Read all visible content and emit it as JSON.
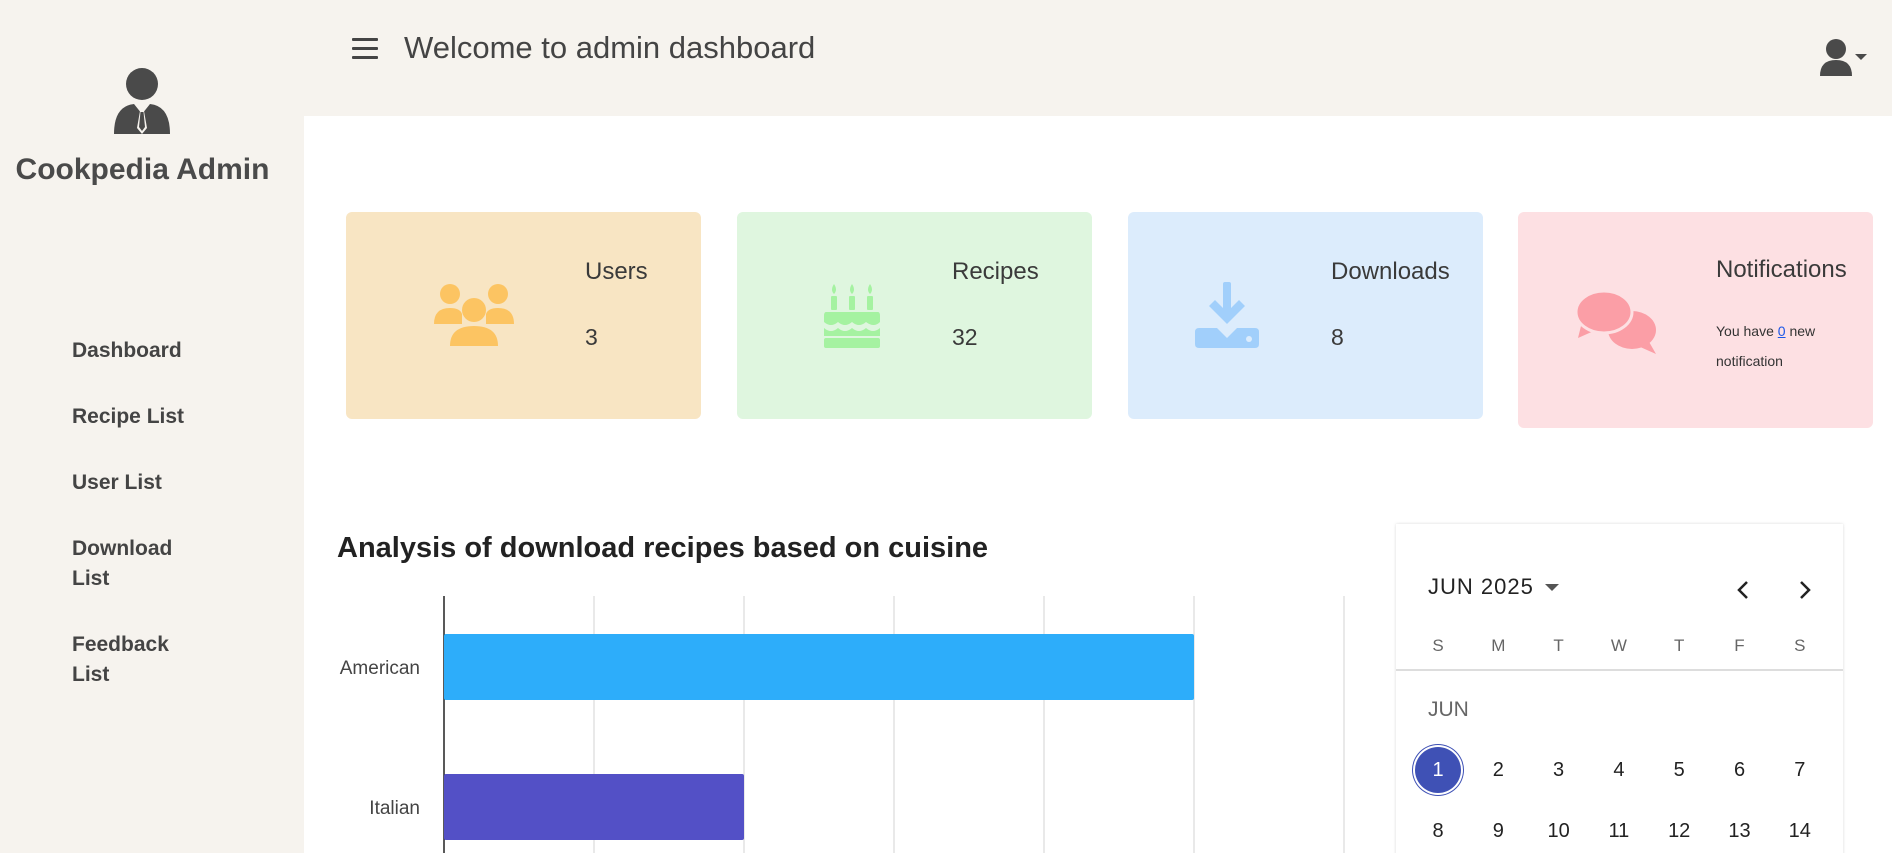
{
  "sidebar": {
    "brand": "Cookpedia Admin",
    "items": [
      {
        "label": "Dashboard"
      },
      {
        "label": "Recipe List"
      },
      {
        "label": "User List"
      },
      {
        "label": "Download List"
      },
      {
        "label": "Feedback List"
      }
    ]
  },
  "header": {
    "title": "Welcome to admin dashboard"
  },
  "cards": {
    "users": {
      "label": "Users",
      "value": "3",
      "color": "#f8e5c3",
      "icon_color": "#fcc462",
      "icon": "users-group-icon"
    },
    "recipes": {
      "label": "Recipes",
      "value": "32",
      "color": "#dff6df",
      "icon_color": "#a5f2a1",
      "icon": "birthday-cake-icon"
    },
    "downloads": {
      "label": "Downloads",
      "value": "8",
      "color": "#dcecfc",
      "icon_color": "#a1cffb",
      "icon": "download-icon"
    },
    "notifications": {
      "label": "Notifications",
      "text_before": "You have ",
      "count": "0",
      "text_after": " new notification",
      "color": "#fde0e3",
      "icon_color": "#fb9ea6",
      "icon": "chat-bubbles-icon"
    }
  },
  "chart_data": {
    "type": "bar",
    "orientation": "horizontal",
    "title": "Analysis of download recipes based on cuisine",
    "categories": [
      "American",
      "Italian"
    ],
    "values": [
      5,
      2
    ],
    "colors": [
      "#2dadfa",
      "#5350c6"
    ],
    "xlim": [
      0,
      6
    ],
    "grid": true
  },
  "calendar": {
    "month_year": "JUN 2025",
    "weekdays": [
      "S",
      "M",
      "T",
      "W",
      "T",
      "F",
      "S"
    ],
    "month_label": "JUN",
    "selected_day": 1,
    "visible_days": [
      1,
      2,
      3,
      4,
      5,
      6,
      7,
      8,
      9,
      10,
      11,
      12,
      13,
      14
    ],
    "accent": "#3f51b5"
  }
}
